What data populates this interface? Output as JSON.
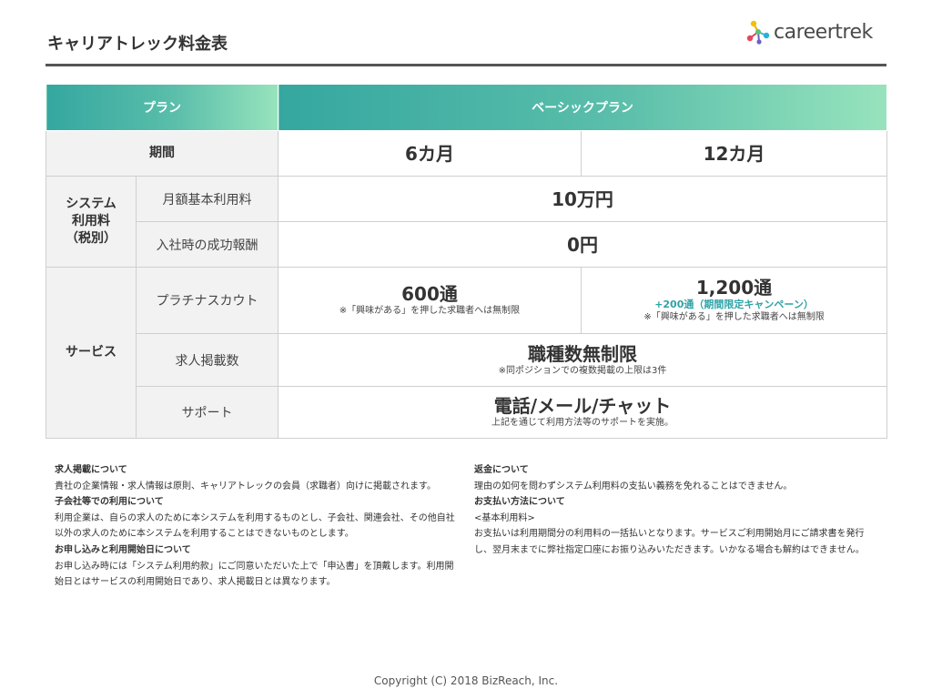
{
  "header": {
    "title": "キャリアトレック料金表",
    "logo_text": "careertrek"
  },
  "table": {
    "head_plan": "プラン",
    "head_basic": "ベーシックプラン",
    "period_label": "期間",
    "period_6": "6カ月",
    "period_12": "12カ月",
    "system_fee_category": [
      "システム",
      "利用料",
      "（税別）"
    ],
    "monthly_fee_label": "月額基本利用料",
    "monthly_fee_value": "10万円",
    "success_fee_label": "入社時の成功報酬",
    "success_fee_value": "0円",
    "service_category": "サービス",
    "scout_label": "プラチナスカウト",
    "scout_6_value": "600通",
    "scout_6_note": "※「興味がある」を押した求職者へは無制限",
    "scout_12_value": "1,200通",
    "scout_12_campaign": "+200通（期間限定キャンペーン）",
    "scout_12_note": "※「興味がある」を押した求職者へは無制限",
    "posting_label": "求人掲載数",
    "posting_value": "職種数無制限",
    "posting_note": "※同ポジションでの複数掲載の上限は3件",
    "support_label": "サポート",
    "support_value": "電話/メール/チャット",
    "support_note": "上記を通じて利用方法等のサポートを実施。"
  },
  "notes_left": [
    {
      "heading": "求人掲載について",
      "body": "貴社の企業情報・求人情報は原則、キャリアトレックの会員（求職者）向けに掲載されます。"
    },
    {
      "heading": "子会社等での利用について",
      "body": "利用企業は、自らの求人のために本システムを利用するものとし、子会社、関連会社、その他自社以外の求人のために本システムを利用することはできないものとします。"
    },
    {
      "heading": "お申し込みと利用開始日について",
      "body": "お申し込み時には「システム利用約款」にご同意いただいた上で「申込書」を頂戴します。利用開始日とはサービスの利用開始日であり、求人掲載日とは異なります。"
    }
  ],
  "notes_right": [
    {
      "heading": "返金について",
      "body": "理由の如何を問わずシステム利用料の支払い義務を免れることはできません。"
    },
    {
      "heading": "お支払い方法について",
      "subheading": "<基本利用料>",
      "body": "お支払いは利用期間分の利用料の一括払いとなります。サービスご利用開始月にご請求書を発行し、翌月末までに弊社指定口座にお振り込みいただきます。いかなる場合も解約はできません。"
    }
  ],
  "copyright": "Copyright (C) 2018 BizReach, Inc.",
  "colors": {
    "header_gradient_start": "#35a7a0",
    "header_gradient_end": "#97e3bd",
    "campaign_text": "#2fa3a6",
    "category_bg": "#f2f2f2"
  }
}
